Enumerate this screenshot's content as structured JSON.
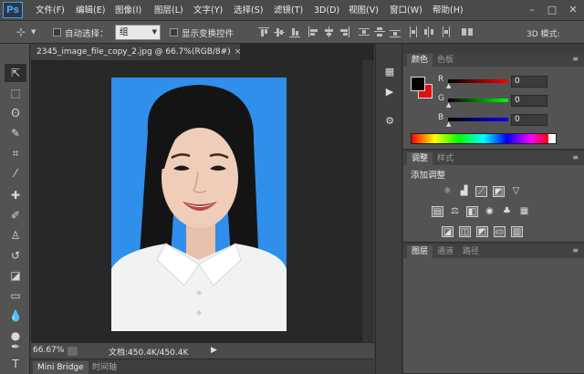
{
  "app": {
    "logo": "Ps",
    "menu": [
      "文件(F)",
      "编辑(E)",
      "图像(I)",
      "图层(L)",
      "文字(Y)",
      "选择(S)",
      "滤镜(T)",
      "3D(D)",
      "视图(V)",
      "窗口(W)",
      "帮助(H)"
    ],
    "window_controls": [
      "–",
      "□",
      "✕"
    ]
  },
  "options": {
    "auto_select_label": "自动选择：",
    "auto_select_value": "组",
    "show_transform_label": "显示变换控件",
    "mode_3d_label": "3D 模式:"
  },
  "document": {
    "tab_title": "2345_image_file_copy_2.jpg @ 66.7%(RGB/8#)",
    "tab_close": "×",
    "zoom": "66.67%",
    "doc_size": "文档:450.4K/450.4K",
    "status_arrow": "▶"
  },
  "bottom_tabs": [
    "Mini Bridge",
    "时间轴"
  ],
  "color_panel": {
    "tabs": [
      "颜色",
      "色板"
    ],
    "channels": [
      {
        "label": "R",
        "value": "0",
        "color": "#e02020"
      },
      {
        "label": "G",
        "value": "0",
        "color": "#20c020"
      },
      {
        "label": "B",
        "value": "0",
        "color": "#2040e0"
      }
    ],
    "foreground": "#000000",
    "background": "#e01010"
  },
  "adjust_panel": {
    "tabs": [
      "调整",
      "样式"
    ],
    "title": "添加调整"
  },
  "layers_panel": {
    "tabs": [
      "图层",
      "通道",
      "路径"
    ]
  },
  "colors": {
    "photo_bg": "#2f8fea",
    "app_bg": "#535353"
  }
}
